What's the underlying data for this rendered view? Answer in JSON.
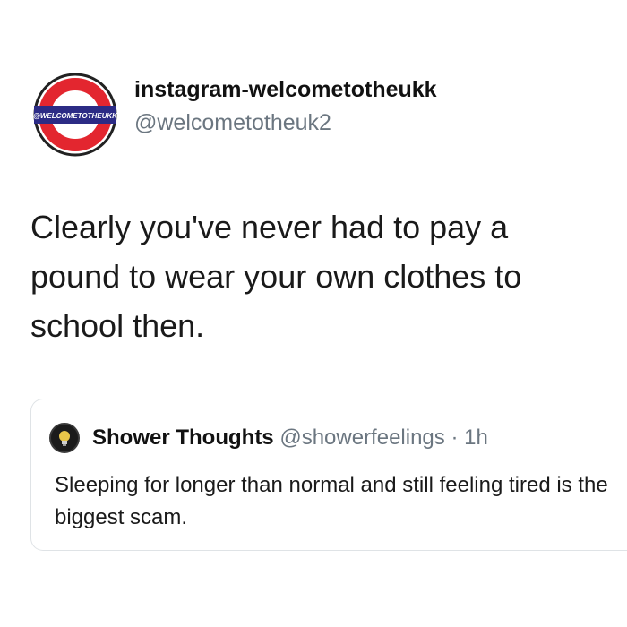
{
  "tweet": {
    "author_name": "instagram-welcometotheukk",
    "author_handle": "@welcometotheuk2",
    "avatar_label": "@WELCOMETOTHEUKK",
    "text": "Clearly you've never had to pay a pound to wear your own clothes to school then."
  },
  "quoted_tweet": {
    "author_name": "Shower Thoughts",
    "author_handle": "@showerfeelings",
    "time": "· 1h",
    "text": "Sleeping for longer than normal and still feeling tired is the biggest scam."
  },
  "colors": {
    "roundel_red": "#e3262f",
    "roundel_bar": "#2c2b85",
    "secondary_text": "#6b7680"
  }
}
